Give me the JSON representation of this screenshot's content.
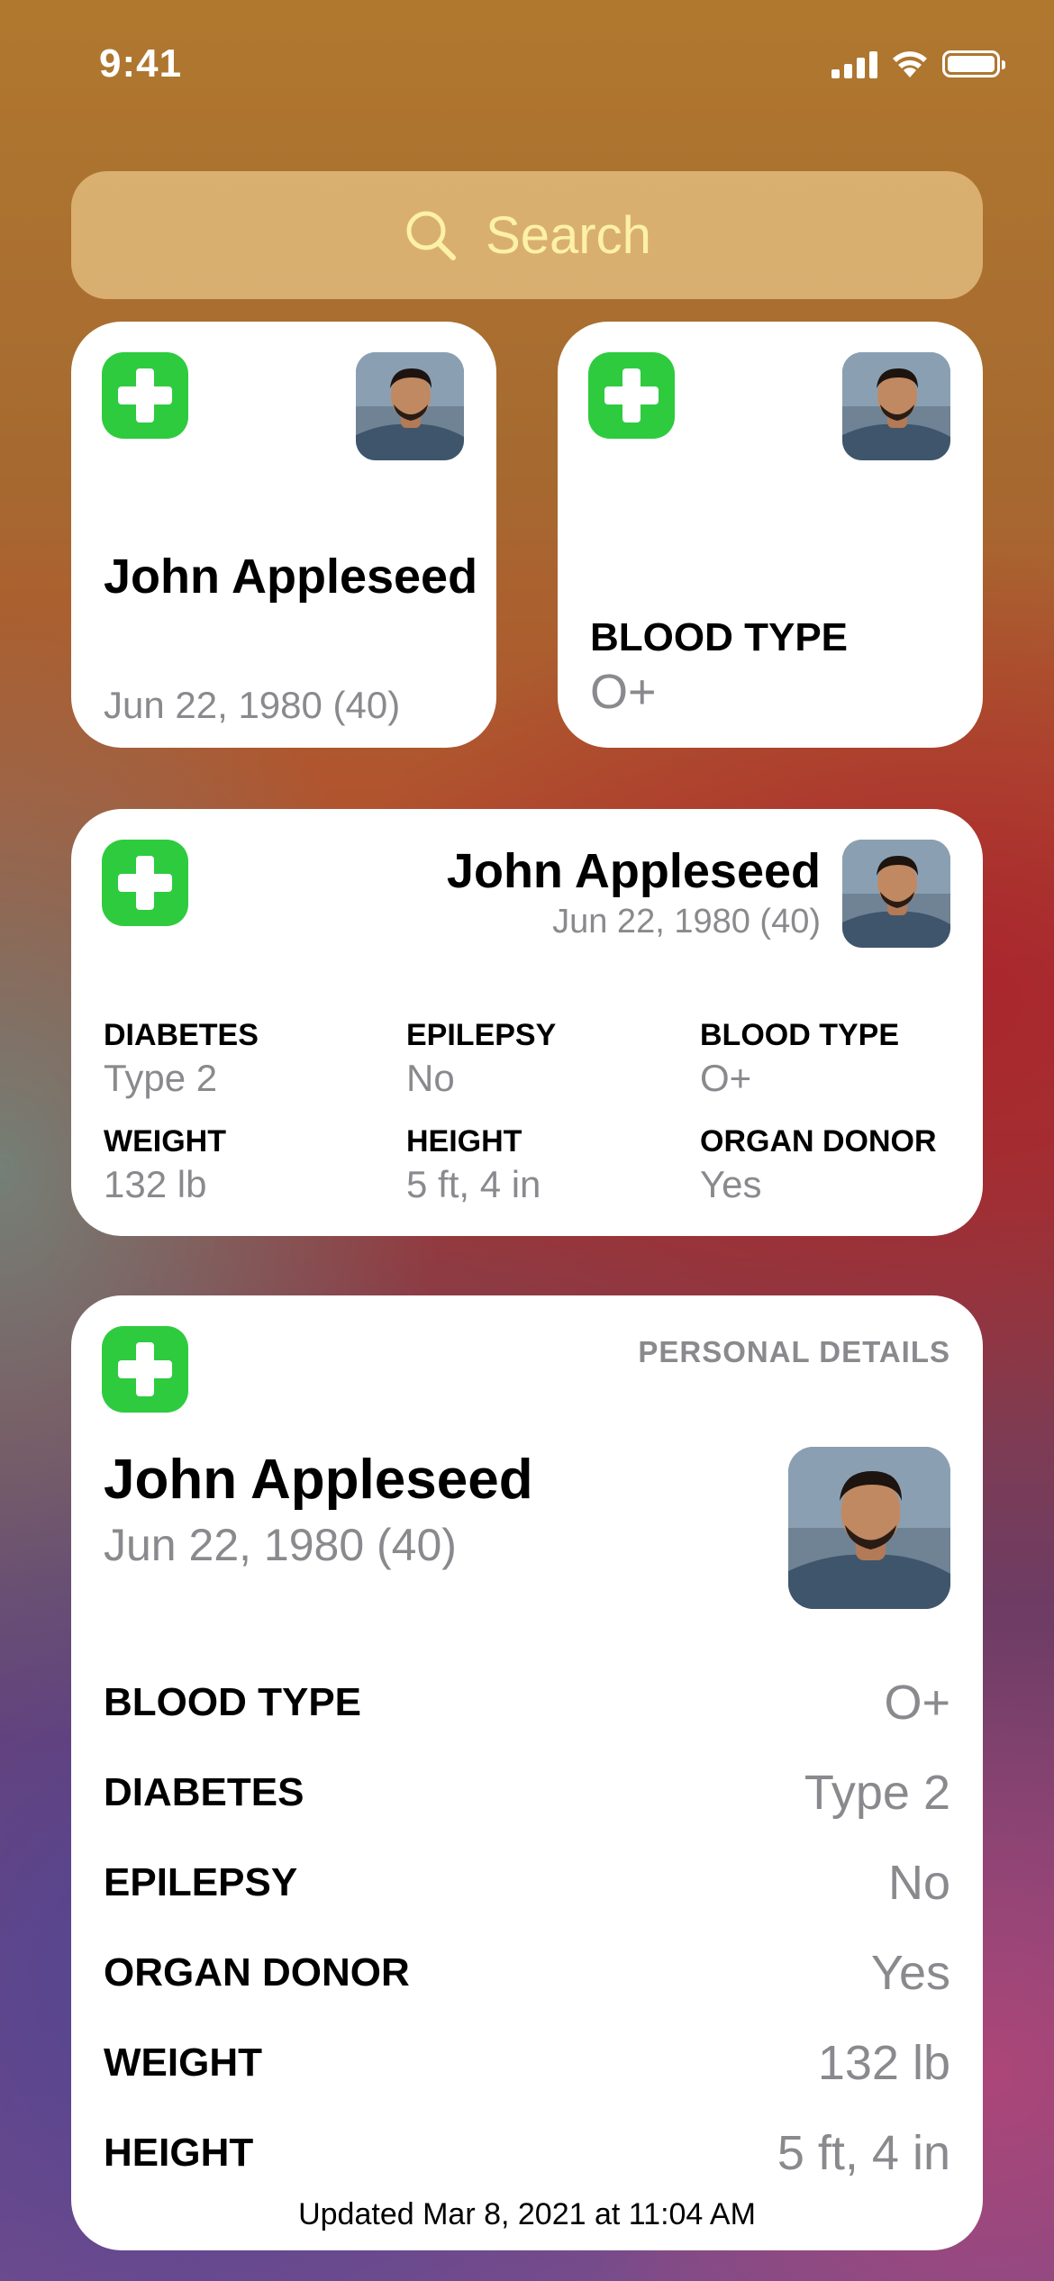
{
  "status_bar": {
    "time": "9:41"
  },
  "search": {
    "placeholder": "Search"
  },
  "colors": {
    "accent_green": "#2ecb3f",
    "secondary_text": "#8a8a8e",
    "search_text": "#fcf1a6"
  },
  "widget_small_name": {
    "name": "John Appleseed",
    "dob": "Jun 22, 1980 (40)"
  },
  "widget_small_blood": {
    "label": "BLOOD TYPE",
    "value": "O+"
  },
  "widget_medium": {
    "name": "John Appleseed",
    "dob": "Jun 22, 1980 (40)",
    "fields": [
      {
        "label": "DIABETES",
        "value": "Type 2"
      },
      {
        "label": "EPILEPSY",
        "value": "No"
      },
      {
        "label": "BLOOD TYPE",
        "value": "O+"
      },
      {
        "label": "WEIGHT",
        "value": "132 lb"
      },
      {
        "label": "HEIGHT",
        "value": "5 ft, 4 in"
      },
      {
        "label": "ORGAN DONOR",
        "value": "Yes"
      }
    ]
  },
  "widget_large": {
    "section_title": "PERSONAL DETAILS",
    "name": "John Appleseed",
    "dob": "Jun 22, 1980 (40)",
    "rows": [
      {
        "label": "BLOOD TYPE",
        "value": "O+"
      },
      {
        "label": "DIABETES",
        "value": "Type 2"
      },
      {
        "label": "EPILEPSY",
        "value": "No"
      },
      {
        "label": "ORGAN DONOR",
        "value": "Yes"
      },
      {
        "label": "WEIGHT",
        "value": "132 lb"
      },
      {
        "label": "HEIGHT",
        "value": "5 ft, 4 in"
      }
    ],
    "updated": "Updated Mar 8, 2021 at 11:04 AM"
  }
}
